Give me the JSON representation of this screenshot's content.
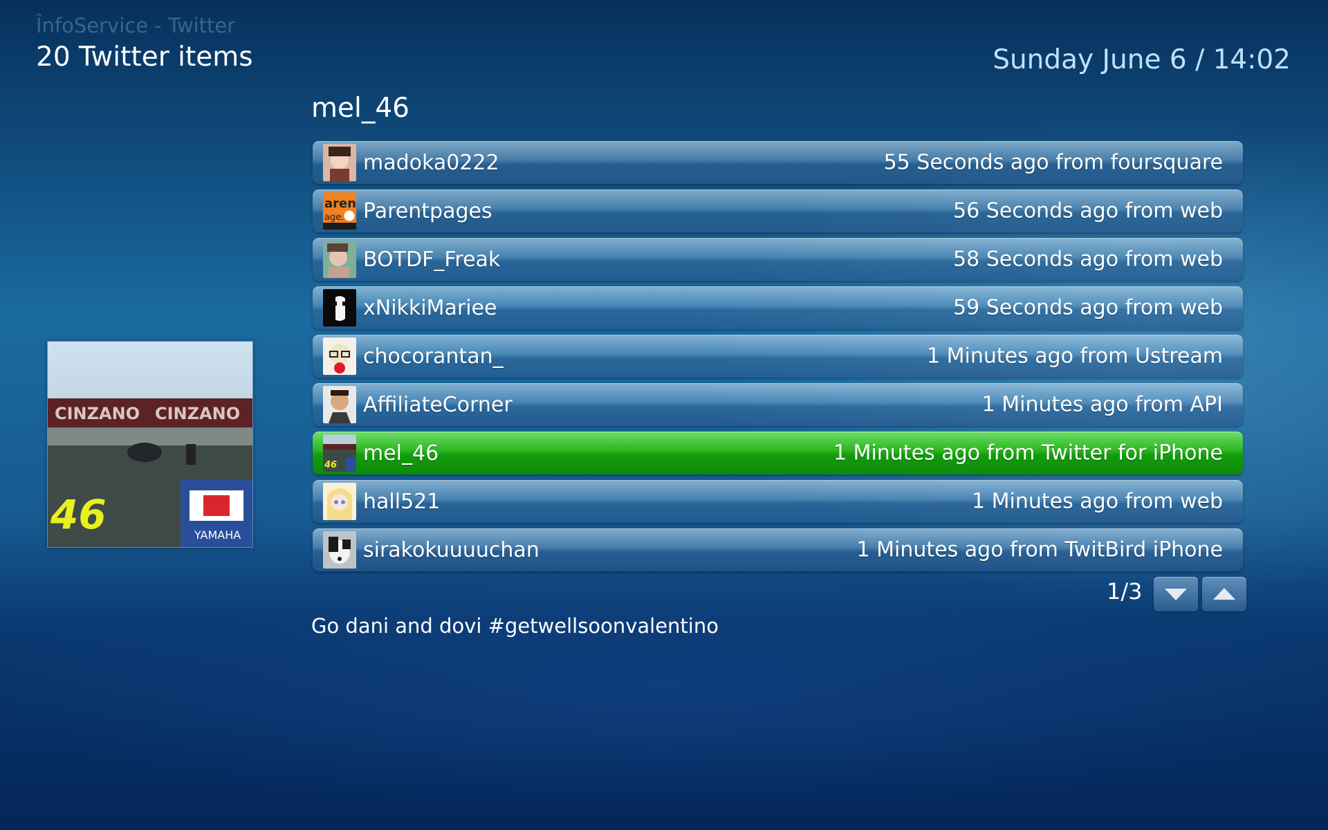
{
  "header": {
    "app_title": "ÎnfoService - Twitter",
    "item_count": "20 Twitter items",
    "datetime": "Sunday June 6 / 14:02"
  },
  "selected": {
    "username": "mel_46",
    "tweet_text": "Go dani and dovi #getwellsoonvalentino",
    "thumbnail_icon": "motorcycle-track-photo"
  },
  "list": {
    "items": [
      {
        "username": "madoka0222",
        "meta": "55 Seconds ago from foursquare",
        "avatar": "avatar-photo",
        "selected": false
      },
      {
        "username": "Parentpages",
        "meta": "56 Seconds ago from web",
        "avatar": "avatar-logo",
        "selected": false
      },
      {
        "username": "BOTDF_Freak",
        "meta": "58 Seconds ago from web",
        "avatar": "avatar-photo",
        "selected": false
      },
      {
        "username": "xNikkiMariee",
        "meta": "59 Seconds ago from web",
        "avatar": "avatar-photo",
        "selected": false
      },
      {
        "username": "chocorantan_",
        "meta": "1 Minutes ago from Ustream",
        "avatar": "avatar-drawing",
        "selected": false
      },
      {
        "username": "AffiliateCorner",
        "meta": "1 Minutes ago from API",
        "avatar": "avatar-photo",
        "selected": false
      },
      {
        "username": "mel_46",
        "meta": "1 Minutes ago from Twitter for iPhone",
        "avatar": "avatar-photo",
        "selected": true
      },
      {
        "username": "hall521",
        "meta": "1 Minutes ago from web",
        "avatar": "avatar-drawing",
        "selected": false
      },
      {
        "username": "sirakokuuuuchan",
        "meta": "1 Minutes ago from TwitBird iPhone",
        "avatar": "avatar-photo",
        "selected": false
      }
    ]
  },
  "pager": {
    "label": "1/3",
    "down_icon": "chevron-down-icon",
    "up_icon": "chevron-up-icon"
  },
  "colors": {
    "selected_row": "#1aa515",
    "background": "#175b92",
    "datetime_text": "#bfe0ff"
  }
}
